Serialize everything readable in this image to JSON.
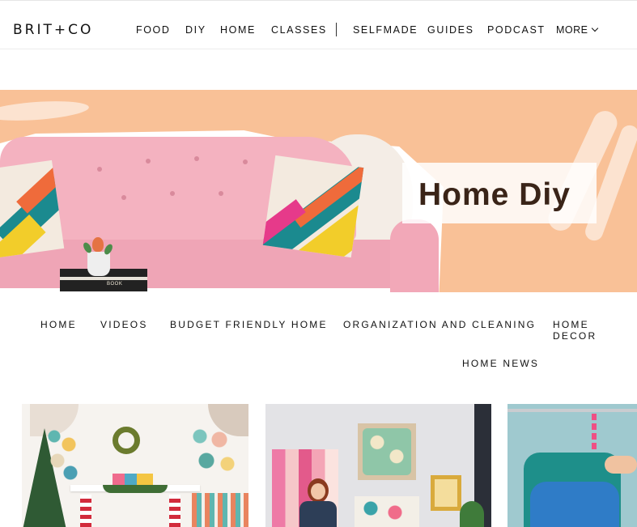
{
  "brand": {
    "logo": "BRIT+CO"
  },
  "topnav": {
    "items": [
      "FOOD",
      "DIY",
      "HOME",
      "CLASSES",
      "SELFMADE",
      "GUIDES",
      "PODCAST"
    ],
    "more_label": "MORE"
  },
  "hero": {
    "title": "Home Diy",
    "background_color": "#f9c197",
    "book_text": "BOOK"
  },
  "subnav": {
    "items": [
      "HOME",
      "VIDEOS",
      "BUDGET FRIENDLY HOME",
      "ORGANIZATION AND CLEANING",
      "HOME DECOR",
      "HOME NEWS"
    ]
  },
  "cards": [
    {
      "image": "holiday-fireplace-mantel-photo"
    },
    {
      "image": "woman-with-art-wall-photo"
    },
    {
      "image": "hangers-and-shirts-photo"
    }
  ]
}
